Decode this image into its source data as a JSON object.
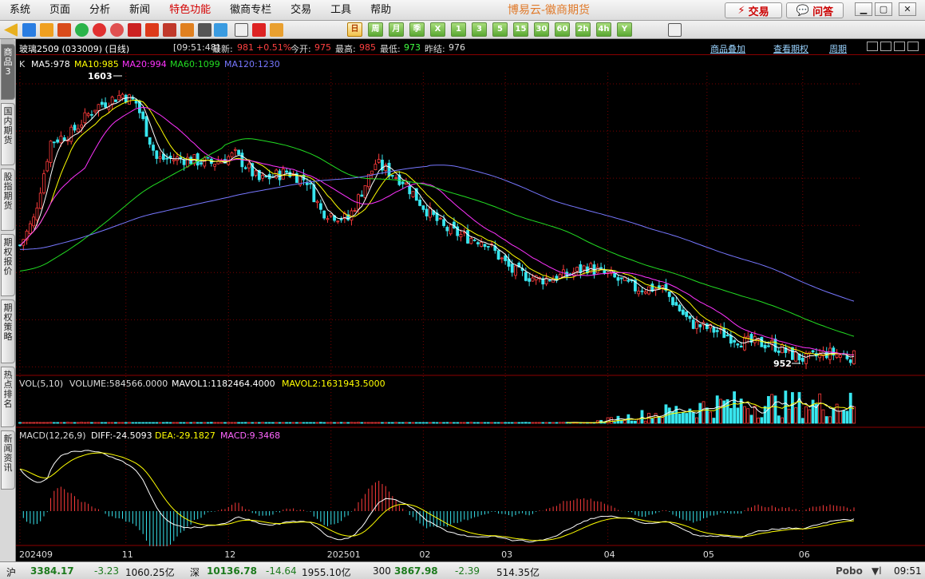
{
  "app": {
    "brand": "博易云-徽商期货",
    "trade_label": "交易",
    "qa_label": "问答"
  },
  "menus": [
    "系统",
    "页面",
    "分析",
    "新闻",
    "特色功能",
    "徽商专栏",
    "交易",
    "工具",
    "帮助"
  ],
  "menu_highlight": "特色功能",
  "periods": [
    "日",
    "周",
    "月",
    "季",
    "X",
    "1",
    "3",
    "5",
    "15",
    "30",
    "60",
    "2h",
    "4h",
    "Y"
  ],
  "period_selected": "日",
  "left_tabs": [
    {
      "label": "商品3",
      "active": true
    },
    {
      "label": "国内期货",
      "active": false
    },
    {
      "label": "股指期货",
      "active": false
    },
    {
      "label": "期权报价",
      "active": false
    },
    {
      "label": "期权策略",
      "active": false
    },
    {
      "label": "热点排名",
      "active": false
    },
    {
      "label": "新闻资讯",
      "active": false
    }
  ],
  "info": {
    "symbol": "玻璃2509 (033009) (日线)",
    "time": "[09:51:48]",
    "latest_label": "最新:",
    "latest": "981",
    "change": "+0.51%",
    "open_label": "今开:",
    "open": "975",
    "high_label": "最高:",
    "high": "985",
    "low_label": "最低:",
    "low": "973",
    "prev_label": "昨结:",
    "prev": "976",
    "links": [
      "商品叠加",
      "查看期权",
      "周期"
    ]
  },
  "ma": {
    "k": "K",
    "ma5": "MA5:978",
    "ma10": "MA10:985",
    "ma20": "MA20:994",
    "ma60": "MA60:1099",
    "ma120": "MA120:1230"
  },
  "vol": {
    "title": "VOL(5,10)",
    "volume": "VOLUME:584566.0000",
    "mavol1": "MAVOL1:1182464.4000",
    "mavol2": "MAVOL2:1631943.5000"
  },
  "macd": {
    "title": "MACD(12,26,9)",
    "diff": "DIFF:-24.5093",
    "dea": "DEA:-29.1827",
    "macd": "MACD:9.3468"
  },
  "markers": {
    "high": "1603",
    "low": "952"
  },
  "x_labels": [
    {
      "label": "202409",
      "i": 0
    },
    {
      "label": "11",
      "i": 31
    },
    {
      "label": "12",
      "i": 61
    },
    {
      "label": "202501",
      "i": 91
    },
    {
      "label": "02",
      "i": 118
    },
    {
      "label": "03",
      "i": 142
    },
    {
      "label": "04",
      "i": 172
    },
    {
      "label": "05",
      "i": 201
    },
    {
      "label": "06",
      "i": 229
    }
  ],
  "colors": {
    "up": "#ff3b3b",
    "down": "#38e6ef",
    "ma5": "#ffffff",
    "ma10": "#ffff00",
    "ma20": "#ff33ff",
    "ma60": "#22dd22",
    "ma120": "#7777ff"
  },
  "status": {
    "sh_label": "沪",
    "sh_val": "3384.17",
    "sh_chg": "-3.23",
    "sh_amt": "1060.25亿",
    "sz_label": "深",
    "sz_val": "10136.78",
    "sz_chg": "-14.64",
    "sz_amt": "1955.10亿",
    "c300_label": "300",
    "c300_val": "3867.98",
    "c300_chg": "-2.39",
    "c300_amt": "514.35亿",
    "pobo": "Pobo",
    "clock": "09:51"
  },
  "chart_data": {
    "type": "candlestick",
    "bar_count": 245,
    "price_range": [
      940,
      1640
    ],
    "series_waypoints": [
      {
        "i": 0,
        "price": 1240
      },
      {
        "i": 4,
        "price": 1300
      },
      {
        "i": 9,
        "price": 1480
      },
      {
        "i": 15,
        "price": 1500
      },
      {
        "i": 22,
        "price": 1560
      },
      {
        "i": 30,
        "price": 1590
      },
      {
        "i": 34,
        "price": 1570
      },
      {
        "i": 40,
        "price": 1440
      },
      {
        "i": 48,
        "price": 1440
      },
      {
        "i": 56,
        "price": 1430
      },
      {
        "i": 63,
        "price": 1450
      },
      {
        "i": 70,
        "price": 1390
      },
      {
        "i": 78,
        "price": 1410
      },
      {
        "i": 84,
        "price": 1390
      },
      {
        "i": 88,
        "price": 1320
      },
      {
        "i": 96,
        "price": 1300
      },
      {
        "i": 104,
        "price": 1430
      },
      {
        "i": 112,
        "price": 1390
      },
      {
        "i": 118,
        "price": 1330
      },
      {
        "i": 124,
        "price": 1280
      },
      {
        "i": 130,
        "price": 1260
      },
      {
        "i": 136,
        "price": 1250
      },
      {
        "i": 144,
        "price": 1180
      },
      {
        "i": 152,
        "price": 1160
      },
      {
        "i": 160,
        "price": 1170
      },
      {
        "i": 166,
        "price": 1190
      },
      {
        "i": 172,
        "price": 1170
      },
      {
        "i": 180,
        "price": 1140
      },
      {
        "i": 188,
        "price": 1140
      },
      {
        "i": 196,
        "price": 1060
      },
      {
        "i": 204,
        "price": 1040
      },
      {
        "i": 212,
        "price": 1015
      },
      {
        "i": 220,
        "price": 1010
      },
      {
        "i": 226,
        "price": 985
      },
      {
        "i": 230,
        "price": 975
      },
      {
        "i": 236,
        "price": 990
      },
      {
        "i": 244,
        "price": 981
      }
    ]
  }
}
